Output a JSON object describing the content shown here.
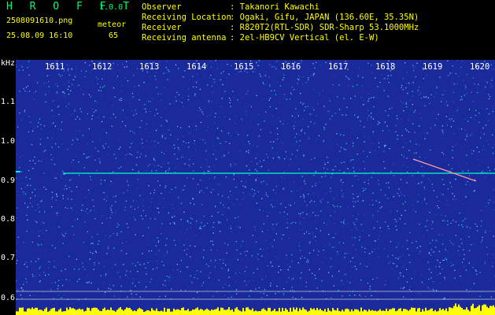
{
  "header": {
    "app_title": "H R O F F T",
    "version": "1.0.0",
    "filename": "2508091610.png",
    "datetime": "25.08.09 16:10",
    "mode_label": "meteor",
    "count": "65",
    "info": [
      {
        "label": "Observer",
        "value": ": Takanori Kawachi"
      },
      {
        "label": "Receiving Location",
        "value": ": Ogaki, Gifu, JAPAN (136.60E, 35.35N)"
      },
      {
        "label": "Receiver",
        "value": ": R820T2(RTL-SDR) SDR-Sharp 53.1000MHz"
      },
      {
        "label": "Receiving antenna",
        "value": ": 2el-HB9CV Vertical (el. E-W)"
      }
    ]
  },
  "spectrogram": {
    "y_unit": "kHz",
    "y_ticks": [
      "1.1",
      "1.0",
      "0.9",
      "0.8",
      "0.7",
      "0.6"
    ],
    "x_ticks": [
      "1611",
      "1612",
      "1613",
      "1614",
      "1615",
      "1616",
      "1617",
      "1618",
      "1619",
      "1620"
    ],
    "background_color": "#1a2a9a",
    "carrier_freq_khz": 0.92,
    "colors": {
      "label_yellow": "#ffff00",
      "label_green": "#00ff66",
      "signal_cyan": "#00ffcc",
      "baseline_yellow": "#ffff00"
    }
  }
}
